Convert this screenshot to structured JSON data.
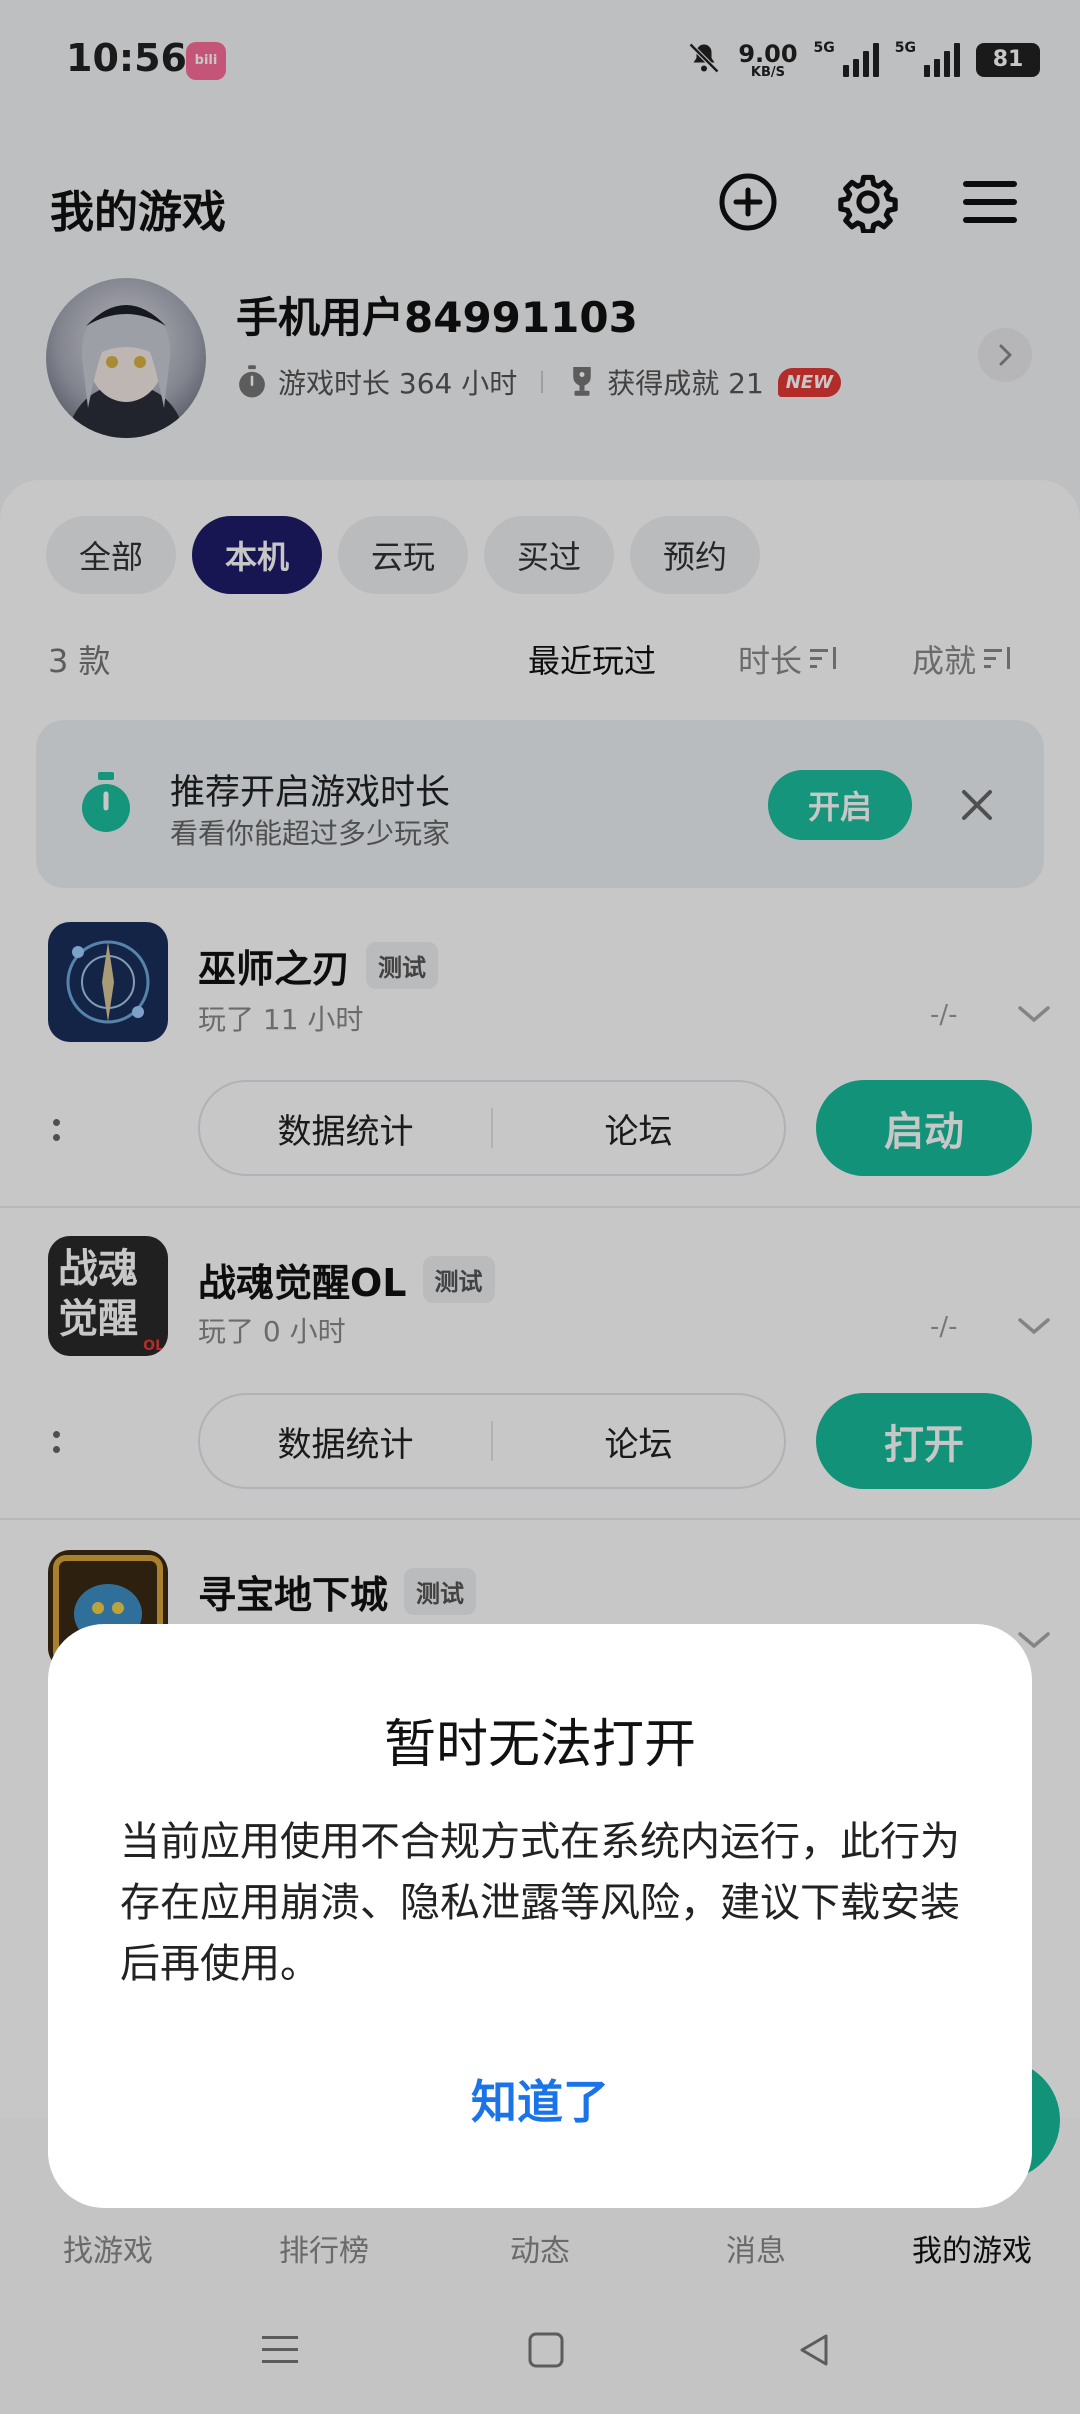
{
  "status_bar": {
    "time": "10:56",
    "app_badge": "bilibili",
    "net_speed": "9.00",
    "net_unit": "KB/S",
    "sim1": "5G",
    "sim2": "5G",
    "battery": "81"
  },
  "header": {
    "title": "我的游戏"
  },
  "profile": {
    "username": "手机用户84991103",
    "playtime": "游戏时长 364 小时",
    "achievements": "获得成就 21",
    "new_badge": "NEW"
  },
  "filter_tabs": [
    {
      "label": "全部"
    },
    {
      "label": "本机"
    },
    {
      "label": "云玩"
    },
    {
      "label": "买过"
    },
    {
      "label": "预约"
    }
  ],
  "sort": {
    "count": "3 款",
    "recent": "最近玩过",
    "duration": "时长",
    "achievement": "成就"
  },
  "tip": {
    "title": "推荐开启游戏时长",
    "subtitle": "看看你能超过多少玩家",
    "button": "开启"
  },
  "games": [
    {
      "name": "巫师之刃",
      "tag": "测试",
      "meta": "玩了 11 小时",
      "dash": "-/-",
      "stats": "数据统计",
      "forum": "论坛",
      "action": "启动"
    },
    {
      "name": "战魂觉醒OL",
      "tag": "测试",
      "meta": "玩了 0 小时",
      "dash": "-/-",
      "stats": "数据统计",
      "forum": "论坛",
      "action": "打开",
      "icon_text_1": "战魂",
      "icon_text_2": "觉醒",
      "icon_text_3": "OL"
    },
    {
      "name": "寻宝地下城",
      "tag": "测试"
    }
  ],
  "bottom_nav": [
    {
      "label": "找游戏"
    },
    {
      "label": "排行榜"
    },
    {
      "label": "动态"
    },
    {
      "label": "消息"
    },
    {
      "label": "我的游戏"
    }
  ],
  "dialog": {
    "title": "暂时无法打开",
    "body": "当前应用使用不合规方式在系统内运行，此行为存在应用崩溃、隐私泄露等风险，建议下载安装后再使用。",
    "ok": "知道了"
  },
  "colors": {
    "accent": "#17bc9c",
    "active_tab": "#1f1c6b",
    "link": "#1a73e8",
    "new_badge": "#e53935"
  }
}
